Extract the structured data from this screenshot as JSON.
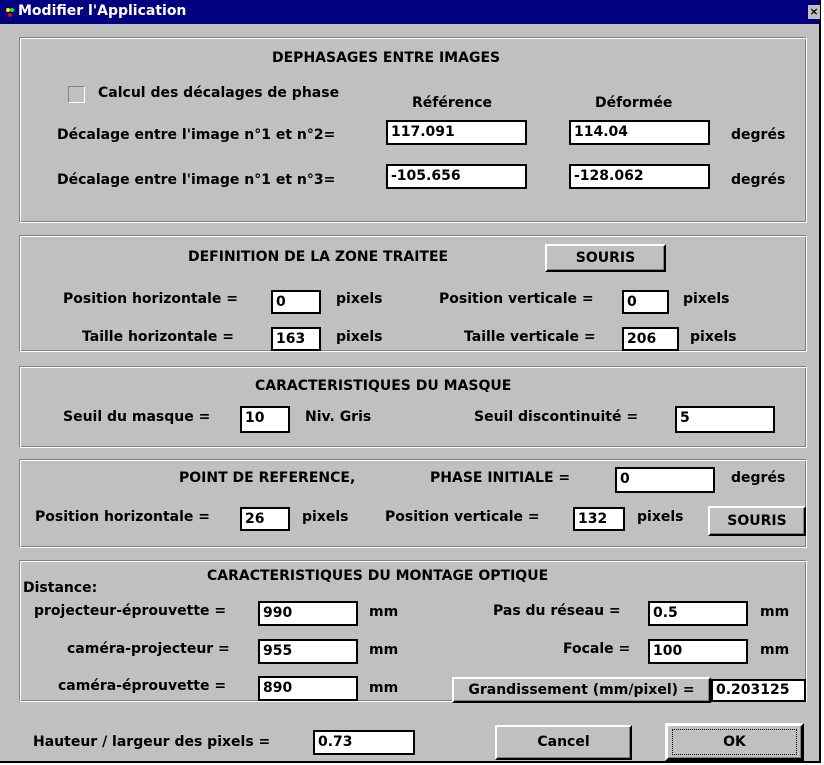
{
  "window": {
    "title": "Modifier l'Application",
    "close_glyph": "×"
  },
  "phase": {
    "heading": "DEPHASAGES ENTRE IMAGES",
    "checkbox_label": "Calcul des décalages de phase",
    "col_reference": "Référence",
    "col_deformee": "Déformée",
    "row1_label": "Décalage entre l'image n°1 et n°2=",
    "row1_reference": "117.091",
    "row1_deformee": "114.04",
    "row1_unit": "degrés",
    "row2_label": "Décalage entre l'image n°1 et n°3=",
    "row2_reference": "-105.656",
    "row2_deformee": "-128.062",
    "row2_unit": "degrés"
  },
  "zone": {
    "heading": "DEFINITION DE LA ZONE TRAITEE",
    "souris_label": "SOURIS",
    "pos_h_label": "Position horizontale =",
    "pos_h_value": "0",
    "pos_h_unit": "pixels",
    "pos_v_label": "Position verticale =",
    "pos_v_value": "0",
    "pos_v_unit": "pixels",
    "size_h_label": "Taille horizontale =",
    "size_h_value": "163",
    "size_h_unit": "pixels",
    "size_v_label": "Taille verticale =",
    "size_v_value": "206",
    "size_v_unit": "pixels"
  },
  "masque": {
    "heading": "CARACTERISTIQUES DU MASQUE",
    "seuil_label": "Seuil du masque =",
    "seuil_value": "10",
    "seuil_unit": "Niv. Gris",
    "disc_label": "Seuil discontinuité =",
    "disc_value": "5"
  },
  "reference": {
    "heading": "POINT DE REFERENCE,",
    "phase_label": "PHASE INITIALE =",
    "phase_value": "0",
    "phase_unit": "degrés",
    "pos_h_label": "Position horizontale =",
    "pos_h_value": "26",
    "pos_h_unit": "pixels",
    "pos_v_label": "Position verticale =",
    "pos_v_value": "132",
    "pos_v_unit": "pixels",
    "souris_label": "SOURIS"
  },
  "montage": {
    "heading": "CARACTERISTIQUES DU MONTAGE OPTIQUE",
    "distance_label": "Distance:",
    "proj_ep_label": "projecteur-éprouvette =",
    "proj_ep_value": "990",
    "cam_proj_label": "caméra-projecteur =",
    "cam_proj_value": "955",
    "cam_ep_label": "caméra-éprouvette =",
    "cam_ep_value": "890",
    "mm": "mm",
    "pas_label": "Pas du réseau =",
    "pas_value": "0.5",
    "focale_label": "Focale =",
    "focale_value": "100",
    "grand_label": "Grandissement (mm/pixel) =",
    "grand_value": "0.203125"
  },
  "footer": {
    "hl_label": "Hauteur / largeur des pixels =",
    "hl_value": "0.73",
    "cancel_label": "Cancel",
    "ok_label": "OK"
  }
}
